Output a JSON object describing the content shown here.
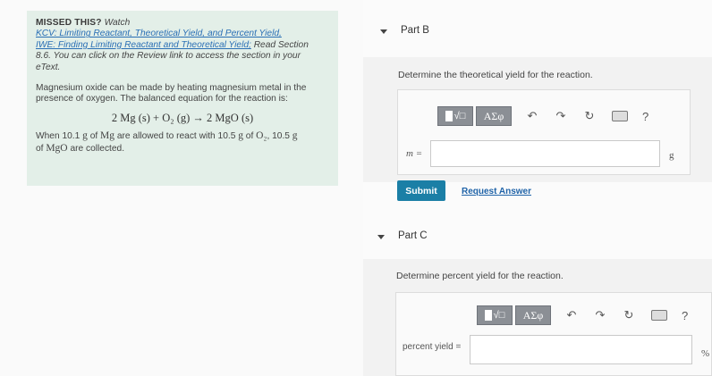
{
  "hint": {
    "missed_label": "MISSED THIS?",
    "watch_label": "Watch",
    "kcv_link": "KCV: Limiting Reactant, Theoretical Yield, and Percent Yield,",
    "iwe_link": "IWE: Finding Limiting Reactant and Theoretical Yield;",
    "read_section_line1": " Read Section",
    "read_section_line2": "8.6. You can click on the Review link to access the section in your",
    "read_section_line3": "eText.",
    "para_line1": "Magnesium oxide can be made by heating magnesium metal in the",
    "para_line2": "presence of oxygen. The balanced equation for the reaction is:",
    "equation": "2 Mg (s) + O₂ (g) → 2 MgO (s)",
    "given_line1_a": "When 10.1 ",
    "given_line1_b": "g",
    "given_line1_c": " of ",
    "given_line1_d": "Mg",
    "given_line1_e": " are allowed to react with 10.5 ",
    "given_line1_f": "g",
    "given_line1_g": " of ",
    "given_line1_h": "O₂",
    "given_line1_i": ", 10.5 ",
    "given_line1_j": "g",
    "given_line2_a": "of ",
    "given_line2_b": "MgO",
    "given_line2_c": " are collected."
  },
  "partB": {
    "header": "Part B",
    "prompt": "Determine the theoretical yield for the reaction.",
    "greek_button": "ΑΣφ",
    "help": "?",
    "input_label": "m =",
    "input_value": "",
    "unit": "g",
    "submit_label": "Submit",
    "request_label": "Request Answer"
  },
  "partC": {
    "header": "Part C",
    "prompt": "Determine percent yield for the reaction.",
    "greek_button": "ΑΣφ",
    "help": "?",
    "input_label": "percent yield =",
    "input_value": "",
    "unit": "%"
  },
  "icons": {
    "undo": "↶",
    "redo": "↷",
    "reset": "↻"
  }
}
